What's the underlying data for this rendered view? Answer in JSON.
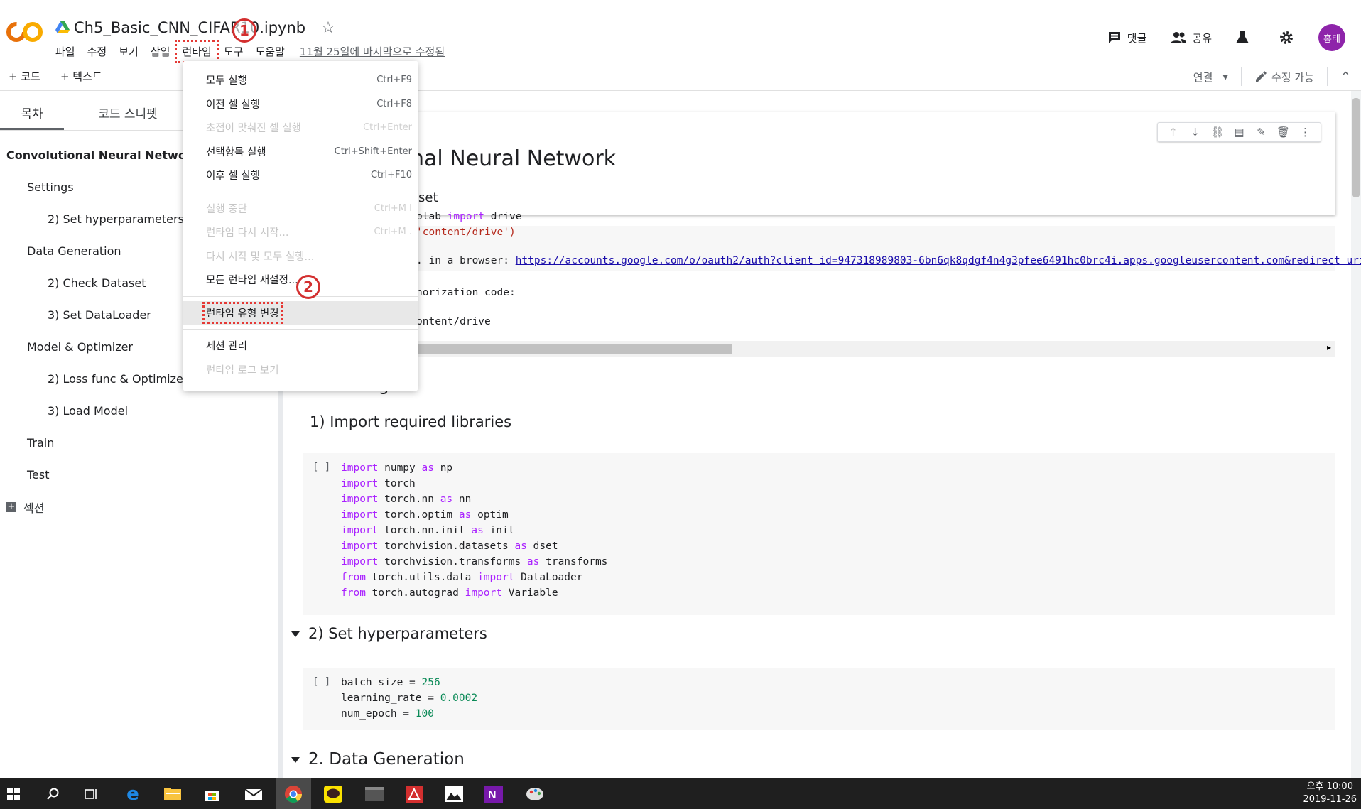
{
  "header": {
    "doc_title": "Ch5_Basic_CNN_CIFAR10.ipynb",
    "menus": [
      "파일",
      "수정",
      "보기",
      "삽입",
      "런타임",
      "도구",
      "도움말"
    ],
    "last_edit": "11월 25일에 마지막으로 수정됨",
    "comment_label": "댓글",
    "share_label": "공유",
    "avatar_label": "홍태"
  },
  "annotations": {
    "one": "1",
    "two": "2"
  },
  "toolbar": {
    "add_code": "+ 코드",
    "add_text": "+ 텍스트",
    "connect": "연결",
    "edit_mode": "수정 가능"
  },
  "sidebar": {
    "tabs": [
      "목차",
      "코드 스니펫"
    ],
    "toc": [
      "Convolutional Neural Network",
      "Settings",
      "2) Set hyperparameters",
      "Data Generation",
      "2) Check Dataset",
      "3) Set DataLoader",
      "Model & Optimizer",
      "2) Loss func & Optimizer",
      "3) Load Model",
      "Train",
      "Test"
    ],
    "add_section": "섹션"
  },
  "dropdown": {
    "items": [
      {
        "label": "모두 실행",
        "shortcut": "Ctrl+F9"
      },
      {
        "label": "이전 셀 실행",
        "shortcut": "Ctrl+F8"
      },
      {
        "label": "초점이 맞춰진 셀 실행",
        "shortcut": "Ctrl+Enter"
      },
      {
        "label": "선택항목 실행",
        "shortcut": "Ctrl+Shift+Enter"
      },
      {
        "label": "이후 셀 실행",
        "shortcut": "Ctrl+F10"
      },
      {
        "label": "실행 중단",
        "shortcut": "Ctrl+M I"
      },
      {
        "label": "런타임 다시 시작...",
        "shortcut": "Ctrl+M ."
      },
      {
        "label": "다시 시작 및 모두 실행...",
        "shortcut": ""
      },
      {
        "label": "모든 런타임 재설정...",
        "shortcut": ""
      },
      {
        "label": "런타임 유형 변경",
        "shortcut": ""
      },
      {
        "label": "세션 관리",
        "shortcut": ""
      },
      {
        "label": "런타임 로그 보기",
        "shortcut": ""
      }
    ]
  },
  "main": {
    "heading_partial": "nal Neural Network",
    "subheading_partial": "aset",
    "mount_code_l1_a": "olab ",
    "mount_code_l1_kw": "import",
    "mount_code_l1_b": " drive",
    "mount_code_l2": "'content/drive')",
    "out_line1_prefix": ". in a browser: ",
    "out_line1_link": "https://accounts.google.com/o/oauth2/auth?client_id=947318989803-6bn6qk8qdgf4n4g3pfee6491hc0brc4i.apps.googleusercontent.com&redirect_uri=urn%3a",
    "out_line2": "horization code:",
    "out_line3": "ontent/drive",
    "section1_partial": "1. Settings",
    "sub1": "1) Import required libraries",
    "imports": [
      {
        "kw1": "import",
        "mid": " numpy ",
        "kw2": "as",
        "end": " np"
      },
      {
        "kw1": "import",
        "mid": " torch",
        "kw2": "",
        "end": ""
      },
      {
        "kw1": "import",
        "mid": " torch.nn ",
        "kw2": "as",
        "end": " nn"
      },
      {
        "kw1": "import",
        "mid": " torch.optim ",
        "kw2": "as",
        "end": " optim"
      },
      {
        "kw1": "import",
        "mid": " torch.nn.init ",
        "kw2": "as",
        "end": " init"
      },
      {
        "kw1": "import",
        "mid": " torchvision.datasets ",
        "kw2": "as",
        "end": " dset"
      },
      {
        "kw1": "import",
        "mid": " torchvision.transforms ",
        "kw2": "as",
        "end": " transforms"
      },
      {
        "kw1": "from",
        "mid": " torch.utils.data ",
        "kw2": "import",
        "end": " DataLoader"
      },
      {
        "kw1": "from",
        "mid": " torch.autograd ",
        "kw2": "import",
        "end": " Variable"
      }
    ],
    "sub2": "2) Set hyperparameters",
    "hyper": [
      {
        "name": "batch_size = ",
        "val": "256"
      },
      {
        "name": "learning_rate = ",
        "val": "0.0002"
      },
      {
        "name": "num_epoch = ",
        "val": "100"
      }
    ],
    "section2": "2. Data Generation",
    "run_bracket": "[ ]"
  },
  "taskbar": {
    "time": "오후 10:00",
    "date": "2019-11-26"
  },
  "colors": {
    "accent_orange": "#f9ab00",
    "annotation_red": "#d32f2f",
    "avatar_purple": "#8e24aa",
    "keyword_purple": "#aa22ff",
    "number_green": "#0b8a57"
  }
}
